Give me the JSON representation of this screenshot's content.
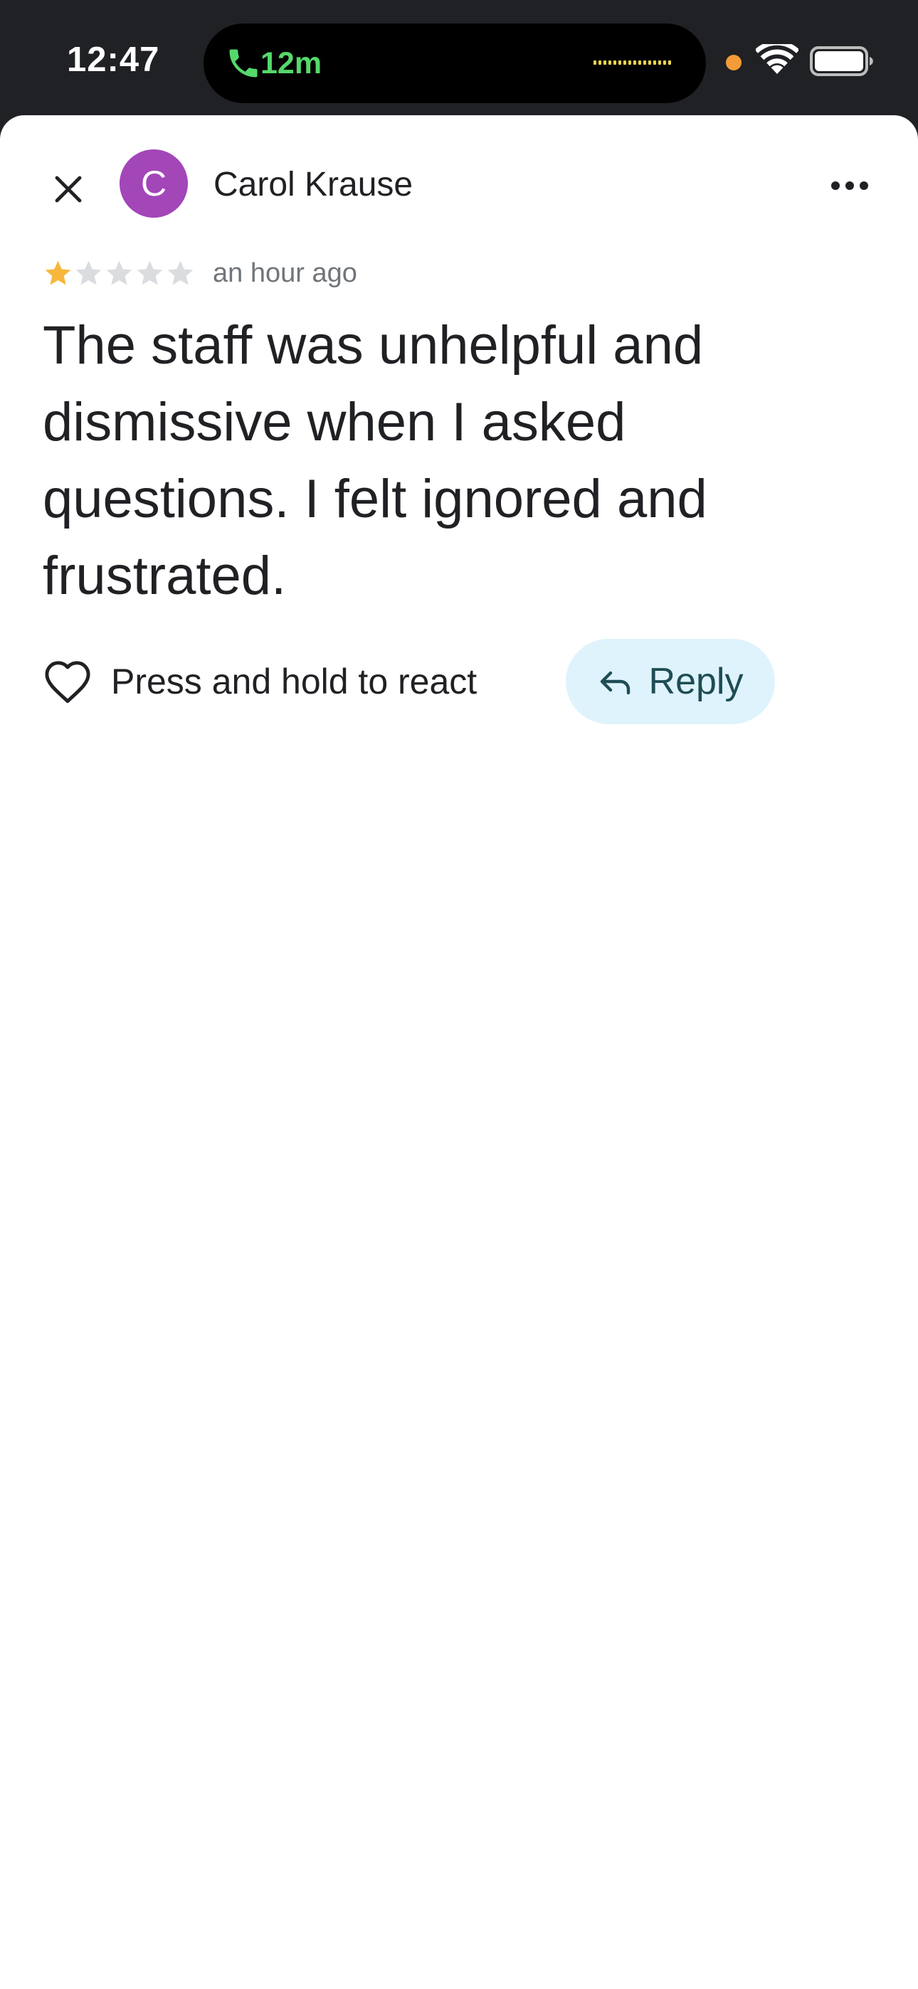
{
  "status_bar": {
    "time": "12:47",
    "call_duration": "12m",
    "icons": [
      "phone-icon",
      "audio-waveform-icon",
      "privacy-indicator-dot",
      "wifi-icon",
      "battery-icon"
    ]
  },
  "review": {
    "author_initial": "C",
    "author_name": "Carol Krause",
    "rating": 1,
    "rating_max": 5,
    "timestamp": "an hour ago",
    "text": "The staff was unhelpful and dismissive when I asked questions. I felt ignored and frustrated."
  },
  "actions": {
    "react_label": "Press and hold to react",
    "reply_label": "Reply"
  },
  "colors": {
    "status_bar_bg": "#202124",
    "avatar": "#a346b8",
    "star_filled": "#f6b73c",
    "star_empty": "#dadce0",
    "reply_bg": "#dff3fc",
    "reply_text": "#1e4d55",
    "call_green": "#55d96b"
  }
}
